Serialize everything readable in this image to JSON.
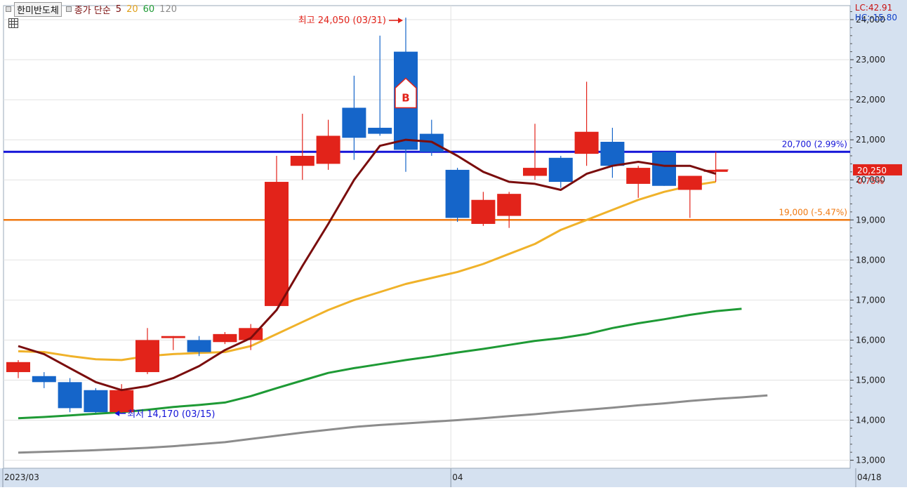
{
  "legend": {
    "symbol": "한미반도체",
    "ma_label": "종가 단순",
    "ma_periods": [
      {
        "label": "5",
        "color": "#7a0d0d"
      },
      {
        "label": "20",
        "color": "#f0b22a"
      },
      {
        "label": "60",
        "color": "#1e9a35"
      },
      {
        "label": "120",
        "color": "#8c8c8c"
      }
    ]
  },
  "indicators": {
    "lc": "LC:42.91",
    "hc": "HC:-15.80"
  },
  "colors": {
    "up": "#e2231a",
    "down": "#1565c9",
    "ma5": "#7a0d0d",
    "ma20": "#f0b22a",
    "ma60": "#1e9a35",
    "ma120": "#8c8c8c",
    "resistance": "#1414d8",
    "support": "#f07a12"
  },
  "chart_data": {
    "type": "candlestick",
    "y_axis": {
      "ylim": [
        12800,
        24350
      ],
      "ticks": [
        13000,
        14000,
        15000,
        16000,
        17000,
        18000,
        19000,
        20000,
        21000,
        22000,
        23000,
        24000
      ],
      "tick_labels": [
        "13,000",
        "14,000",
        "15,000",
        "16,000",
        "17,000",
        "18,000",
        "19,000",
        "20,000",
        "21,000",
        "22,000",
        "23,000",
        "24,000"
      ]
    },
    "x_axis": {
      "labels": [
        {
          "text": "2023/03",
          "index": 0
        },
        {
          "text": "04",
          "index": 17
        },
        {
          "text": "04/18",
          "index": 30
        }
      ]
    },
    "candles": [
      {
        "o": 15200,
        "h": 15500,
        "l": 15050,
        "c": 15450
      },
      {
        "o": 15100,
        "h": 15200,
        "l": 14800,
        "c": 14950
      },
      {
        "o": 14950,
        "h": 15050,
        "l": 14200,
        "c": 14300
      },
      {
        "o": 14750,
        "h": 14800,
        "l": 14180,
        "c": 14200
      },
      {
        "o": 14200,
        "h": 14900,
        "l": 14170,
        "c": 14750
      },
      {
        "o": 15200,
        "h": 16300,
        "l": 15150,
        "c": 16000
      },
      {
        "o": 16050,
        "h": 16100,
        "l": 15750,
        "c": 16100
      },
      {
        "o": 16000,
        "h": 16100,
        "l": 15600,
        "c": 15700
      },
      {
        "o": 15950,
        "h": 16200,
        "l": 15900,
        "c": 16150
      },
      {
        "o": 16000,
        "h": 16400,
        "l": 15750,
        "c": 16300
      },
      {
        "o": 16850,
        "h": 20600,
        "l": 16850,
        "c": 19950
      },
      {
        "o": 20350,
        "h": 21650,
        "l": 20000,
        "c": 20600
      },
      {
        "o": 20400,
        "h": 21500,
        "l": 20250,
        "c": 21100
      },
      {
        "o": 21800,
        "h": 22600,
        "l": 20500,
        "c": 21050
      },
      {
        "o": 21300,
        "h": 23600,
        "l": 21100,
        "c": 21150
      },
      {
        "o": 23200,
        "h": 24050,
        "l": 20200,
        "c": 20750
      },
      {
        "o": 21150,
        "h": 21500,
        "l": 20600,
        "c": 20700
      },
      {
        "o": 20250,
        "h": 20300,
        "l": 18950,
        "c": 19050
      },
      {
        "o": 18900,
        "h": 19700,
        "l": 18850,
        "c": 19500
      },
      {
        "o": 19100,
        "h": 19700,
        "l": 18800,
        "c": 19650
      },
      {
        "o": 20100,
        "h": 21400,
        "l": 20000,
        "c": 20300
      },
      {
        "o": 20550,
        "h": 20600,
        "l": 19800,
        "c": 19950
      },
      {
        "o": 20650,
        "h": 22450,
        "l": 20350,
        "c": 21200
      },
      {
        "o": 20950,
        "h": 21300,
        "l": 20050,
        "c": 20350
      },
      {
        "o": 19900,
        "h": 20350,
        "l": 19550,
        "c": 20300
      },
      {
        "o": 20700,
        "h": 20700,
        "l": 19850,
        "c": 19850
      },
      {
        "o": 19750,
        "h": 20100,
        "l": 19050,
        "c": 20100
      },
      {
        "o": 20200,
        "h": 20700,
        "l": 19950,
        "c": 20250
      }
    ],
    "series": [
      {
        "key": "ma5",
        "values": [
          15850,
          15650,
          15300,
          14950,
          14750,
          14850,
          15050,
          15350,
          15750,
          16050,
          16750,
          17850,
          18900,
          20000,
          20850,
          21000,
          20950,
          20600,
          20200,
          19950,
          19900,
          19750,
          20150,
          20350,
          20450,
          20350,
          20350,
          20150
        ]
      },
      {
        "key": "ma20",
        "values": [
          15720,
          15700,
          15600,
          15520,
          15500,
          15600,
          15650,
          15680,
          15700,
          15850,
          16150,
          16450,
          16750,
          17000,
          17200,
          17400,
          17550,
          17700,
          17900,
          18150,
          18400,
          18750,
          19000,
          19250,
          19500,
          19700,
          19850,
          19950
        ]
      },
      {
        "key": "ma60",
        "values": [
          14050,
          14080,
          14120,
          14160,
          14200,
          14260,
          14330,
          14380,
          14440,
          14600,
          14800,
          14990,
          15180,
          15300,
          15400,
          15500,
          15590,
          15690,
          15780,
          15880,
          15980,
          16050,
          16150,
          16300,
          16420,
          16520,
          16630,
          16720,
          16780
        ]
      },
      {
        "key": "ma120",
        "values": [
          13190,
          13210,
          13230,
          13250,
          13280,
          13310,
          13350,
          13400,
          13450,
          13530,
          13610,
          13690,
          13760,
          13830,
          13880,
          13920,
          13960,
          14000,
          14050,
          14100,
          14150,
          14210,
          14260,
          14310,
          14370,
          14420,
          14480,
          14530,
          14570,
          14620
        ]
      }
    ],
    "levels": [
      {
        "value": 20700,
        "label": "20,700 (2.99%)",
        "color": "resistance"
      },
      {
        "value": 19000,
        "label": "19,000 (-5.47%)",
        "color": "support"
      }
    ],
    "annotations": {
      "high": {
        "label": "최고 24,050 (03/31)",
        "index": 15,
        "value": 24050
      },
      "low": {
        "label": "최저 14,170 (03/15)",
        "index": 4,
        "value": 14170
      },
      "buy_marker": {
        "label": "B",
        "index": 15,
        "value": 21800
      }
    },
    "current_price": {
      "label": "20,250",
      "change": "0.75%",
      "value": 20250,
      "color": "#e2231a"
    }
  }
}
